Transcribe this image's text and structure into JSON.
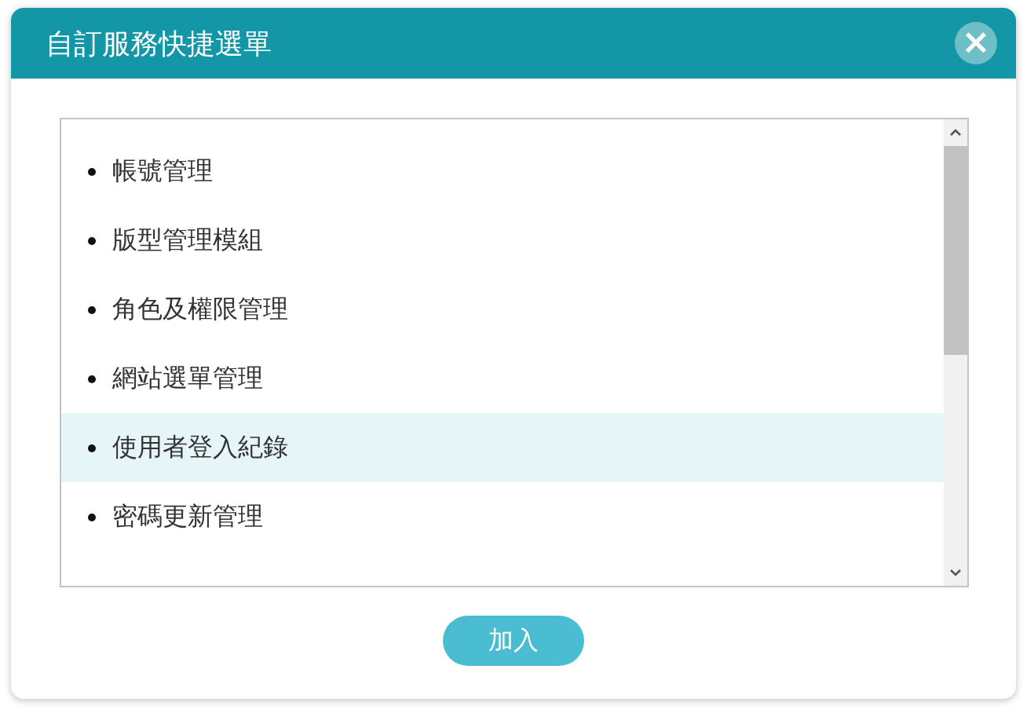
{
  "dialog": {
    "title": "自訂服務快捷選單",
    "close_icon": "×"
  },
  "list": {
    "items": [
      {
        "label": "帳號管理",
        "selected": false
      },
      {
        "label": "版型管理模組",
        "selected": false
      },
      {
        "label": "角色及權限管理",
        "selected": false
      },
      {
        "label": "網站選單管理",
        "selected": false
      },
      {
        "label": "使用者登入紀錄",
        "selected": true
      },
      {
        "label": "密碼更新管理",
        "selected": false
      }
    ]
  },
  "buttons": [
    {
      "label": "加入"
    }
  ]
}
